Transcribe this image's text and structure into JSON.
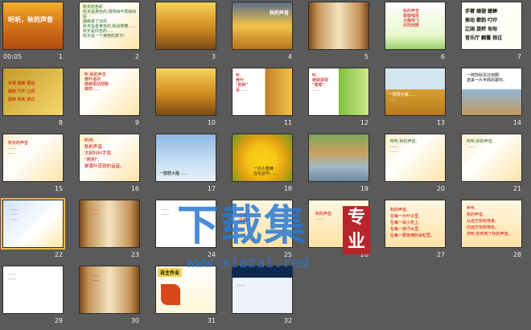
{
  "slides": [
    {
      "num": "1",
      "time": "00:05",
      "title": "听听，秋的声音"
    },
    {
      "num": "2",
      "text": "秋天的色彩\n秋天是黄色的,银杏树叶把给秋姑\n娘扇来了凉风\n秋天是金黄色的,稻谷随着……\n秋天是红色的……\n秋天是一个美丽的季节!"
    },
    {
      "num": "3"
    },
    {
      "num": "4",
      "title": "秋的声音"
    },
    {
      "num": "5"
    },
    {
      "num": "6",
      "text": "秋的声音\n蟋蟀唱歌\n大雁南飞\n风吹田野"
    },
    {
      "num": "7",
      "words": "手臂 蝉翅 蟋蟀\n振动 歌韵 叮咛\n辽阔 旋转 匆匆\n音乐厅 翻覆 掠过"
    },
    {
      "num": "8",
      "words": "手臂 蟋蟀 振动\n歌韵 叮咛 辽阔\n旋转 匆匆 掠过"
    },
    {
      "num": "9",
      "text": "听,秋的声音\n黄叶道别\n蟋蟀振动翅膀\n蝉鸣……"
    },
    {
      "num": "10"
    },
    {
      "num": "11",
      "text": "听,\n黄叶\n“刷刷”\n是……"
    },
    {
      "num": "12",
      "text": "听,\n蟋蟀振翅\n“嚯嚯”\n……"
    },
    {
      "num": "13",
      "text": "一群群大雁……\n……"
    },
    {
      "num": "14",
      "text": "一阵阵秋风过田野,\n送来一片丰收的歌吟。"
    },
    {
      "num": "15",
      "text": "秋天的声音\n……\n……"
    },
    {
      "num": "16",
      "text": "听听,\n秋的声音,\n大树抖抖手臂,\n“刷刷”,\n是黄叶道别的话音。"
    },
    {
      "num": "17",
      "text": "一群群大雁……"
    },
    {
      "num": "18",
      "text": "一只小蜜蜂\n在花丛中……"
    },
    {
      "num": "19"
    },
    {
      "num": "20",
      "text": "听听,秋的声音,\n……\n……"
    },
    {
      "num": "21",
      "text": "听听,秋的声音,\n……"
    },
    {
      "num": "22",
      "text": "……\n……\n……"
    },
    {
      "num": "23",
      "text": "……\n……"
    },
    {
      "num": "24",
      "text": "……\n……"
    },
    {
      "num": "25",
      "text": "在每一……\n在每一……"
    },
    {
      "num": "26",
      "text": "秋的声音,\n……"
    },
    {
      "num": "27",
      "text": "秋的声音,\n在每一片叶子里,\n在每一朵小花上,\n在每一滴汗水里,\n在每一颗饱满的谷粒里。"
    },
    {
      "num": "28",
      "text": "听听,\n秋的声音,\n从远方匆匆地来,\n向远方匆匆地去。\n你听,你听到了秋的声音。"
    },
    {
      "num": "29",
      "text": "……\n……"
    },
    {
      "num": "30",
      "text": "……\n……"
    },
    {
      "num": "31",
      "title": "自主作业"
    },
    {
      "num": "32",
      "text": "……"
    }
  ],
  "watermark": {
    "big": "下载集",
    "site": "www.xiazai.red",
    "badge1": "专",
    "badge2": "业"
  }
}
